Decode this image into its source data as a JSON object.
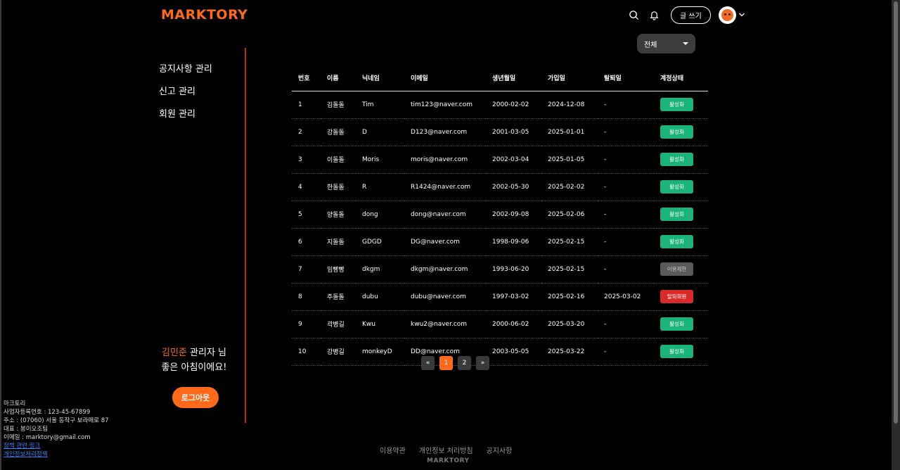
{
  "brand": {
    "logo": "MARKTORY",
    "accent": "#ff6a1a"
  },
  "header": {
    "write_label": "글 쓰기"
  },
  "sidebar": {
    "items": [
      {
        "label": "공지사항 관리"
      },
      {
        "label": "신고 관리"
      },
      {
        "label": "회원 관리"
      }
    ],
    "greeting_name": "김민준",
    "greeting_suffix": " 관리자 님",
    "greeting_line2": "좋은 아침이에요!",
    "logout_label": "로그아웃"
  },
  "filter": {
    "selected": "전체"
  },
  "table": {
    "headers": [
      "번호",
      "이름",
      "닉네임",
      "이메일",
      "생년월일",
      "가입일",
      "탈퇴일",
      "계정상태"
    ],
    "rows": [
      {
        "no": "1",
        "name": "김돌돌",
        "nick": "Tim",
        "email": "tim123@naver.com",
        "birth": "2000-02-02",
        "joined": "2024-12-08",
        "left": "-",
        "status": "활성화",
        "status_type": "active"
      },
      {
        "no": "2",
        "name": "강돌돌",
        "nick": "D",
        "email": "D123@naver.com",
        "birth": "2001-03-05",
        "joined": "2025-01-01",
        "left": "-",
        "status": "활성화",
        "status_type": "active"
      },
      {
        "no": "3",
        "name": "이돌돌",
        "nick": "Moris",
        "email": "moris@naver.com",
        "birth": "2002-03-04",
        "joined": "2025-01-05",
        "left": "-",
        "status": "활성화",
        "status_type": "active"
      },
      {
        "no": "4",
        "name": "한돌돌",
        "nick": "R",
        "email": "R1424@naver.com",
        "birth": "2002-05-30",
        "joined": "2025-02-02",
        "left": "-",
        "status": "활성화",
        "status_type": "active"
      },
      {
        "no": "5",
        "name": "양돌돌",
        "nick": "dong",
        "email": "dong@naver.com",
        "birth": "2002-09-08",
        "joined": "2025-02-06",
        "left": "-",
        "status": "활성화",
        "status_type": "active"
      },
      {
        "no": "6",
        "name": "지돌돌",
        "nick": "GDGD",
        "email": "DG@naver.com",
        "birth": "1998-09-06",
        "joined": "2025-02-15",
        "left": "-",
        "status": "활성화",
        "status_type": "active"
      },
      {
        "no": "7",
        "name": "임빵빵",
        "nick": "dkgm",
        "email": "dkgm@naver.com",
        "birth": "1993-06-20",
        "joined": "2025-02-15",
        "left": "-",
        "status": "이용제한",
        "status_type": "limited"
      },
      {
        "no": "8",
        "name": "주돌돌",
        "nick": "dubu",
        "email": "dubu@naver.com",
        "birth": "1997-03-02",
        "joined": "2025-02-16",
        "left": "2025-03-02",
        "status": "탈퇴회원",
        "status_type": "withdrawn"
      },
      {
        "no": "9",
        "name": "곽병길",
        "nick": "Kwu",
        "email": "kwu2@naver.com",
        "birth": "2000-06-02",
        "joined": "2025-03-20",
        "left": "-",
        "status": "활성화",
        "status_type": "active"
      },
      {
        "no": "10",
        "name": "강병길",
        "nick": "monkeyD",
        "email": "DD@naver.com",
        "birth": "2003-05-05",
        "joined": "2025-03-22",
        "left": "-",
        "status": "활성화",
        "status_type": "active"
      }
    ]
  },
  "pagination": {
    "prev": "«",
    "pages": [
      "1",
      "2"
    ],
    "current": "1",
    "next": "»"
  },
  "company": {
    "name": "마크토리",
    "biz_no": "사업자등록번호 : 123-45-67899",
    "address": "주소 : (07060) 서울 동작구 보라매로 87",
    "ceo": "대표 : 봉이오조팀",
    "email": "이메일 : marktory@gmail.com",
    "link1": "정책 관련 링크",
    "link2": "개인정보처리정책"
  },
  "footer": {
    "links": [
      "이용약관",
      "개인정보 처리방침",
      "공지사항"
    ],
    "logo": "MARKTORY"
  }
}
